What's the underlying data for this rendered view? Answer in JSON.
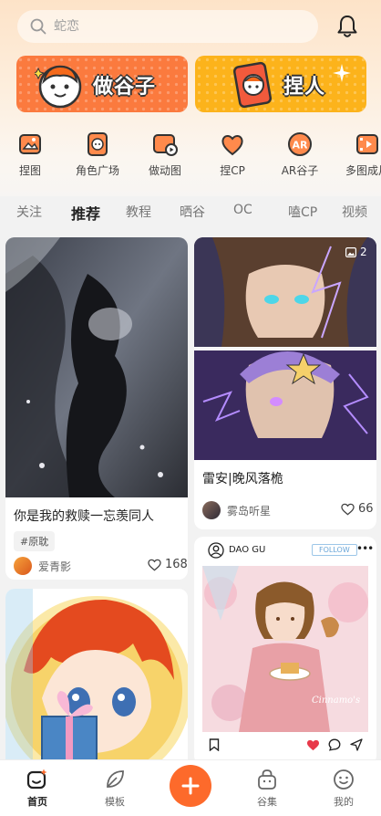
{
  "search": {
    "placeholder": "蛇恋"
  },
  "banners": [
    {
      "label": "做谷子"
    },
    {
      "label": "捏人"
    }
  ],
  "categories": [
    {
      "label": "捏图",
      "icon": "pinch-image-icon"
    },
    {
      "label": "角色广场",
      "icon": "character-square-icon"
    },
    {
      "label": "做动图",
      "icon": "animated-image-icon"
    },
    {
      "label": "捏CP",
      "icon": "heart-cp-icon"
    },
    {
      "label": "AR谷子",
      "icon": "ar-badge-icon"
    },
    {
      "label": "多图成片",
      "icon": "film-strip-icon"
    }
  ],
  "tabs": [
    {
      "label": "关注",
      "active": false
    },
    {
      "label": "推荐",
      "active": true
    },
    {
      "label": "教程",
      "active": false
    },
    {
      "label": "晒谷",
      "active": false
    },
    {
      "label": "OC",
      "active": false
    },
    {
      "label": "嗑CP",
      "active": false
    },
    {
      "label": "视频",
      "active": false
    }
  ],
  "feed": {
    "left": [
      {
        "title": "你是我的救赎一忘羡同人",
        "tag": "#原耽",
        "author": "爱青影",
        "likes": "168"
      },
      {
        "title": ""
      }
    ],
    "right": [
      {
        "badge_count": "2",
        "title": "雷安|晚风落桅",
        "author": "雾岛听星",
        "likes": "66"
      },
      {
        "header_name": "DAO GU",
        "follow_label": "FOLLOW",
        "signature": "Cinnamo's"
      }
    ]
  },
  "bottom_nav": [
    {
      "label": "首页",
      "active": true
    },
    {
      "label": "模板",
      "active": false
    },
    {
      "label": "谷集",
      "active": false
    },
    {
      "label": "我的",
      "active": false
    }
  ],
  "colors": {
    "accent": "#fd6a2b",
    "banner_left": "#fb7a3e",
    "banner_right": "#fcb31b",
    "like_red": "#e8394a"
  }
}
